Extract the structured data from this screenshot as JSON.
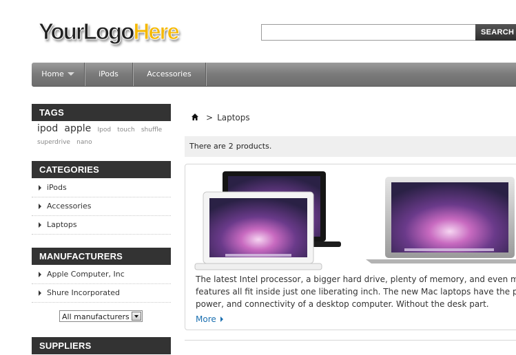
{
  "header": {
    "logo_dark": "YourLogo",
    "logo_highlight": "Here",
    "search": {
      "placeholder": "",
      "value": "",
      "button_label": "SEARCH"
    }
  },
  "nav": {
    "items": [
      {
        "label": "Home",
        "has_dropdown": true
      },
      {
        "label": "iPods"
      },
      {
        "label": "Accessories"
      }
    ]
  },
  "sidebar": {
    "tags": {
      "title": "TAGS",
      "items": [
        "ipod",
        "apple",
        "Ipod",
        "touch",
        "shuffle",
        "superdrive",
        "nano"
      ]
    },
    "categories": {
      "title": "CATEGORIES",
      "items": [
        "iPods",
        "Accessories",
        "Laptops"
      ]
    },
    "manufacturers": {
      "title": "MANUFACTURERS",
      "items": [
        "Apple Computer, Inc",
        "Shure Incorporated"
      ],
      "select_value": "All manufacturers"
    },
    "suppliers": {
      "title": "SUPPLIERS"
    }
  },
  "main": {
    "breadcrumb": {
      "separator": ">",
      "current": "Laptops"
    },
    "count": {
      "prefix": "There are",
      "number": "2",
      "suffix": "products."
    },
    "product": {
      "description_lines": [
        "The latest Intel processor, a bigger hard drive, plenty of memory, and even more new",
        "features all fit inside just one liberating inch. The new Mac laptops have the performance,",
        "power, and connectivity of a desktop computer. Without the desk part."
      ],
      "more_label": "More"
    }
  },
  "colors": {
    "logo_accent": "#f5b800",
    "block_title_bg": "#333333",
    "link": "#1a6fb0",
    "nav_bg": "#7a7a7a"
  }
}
